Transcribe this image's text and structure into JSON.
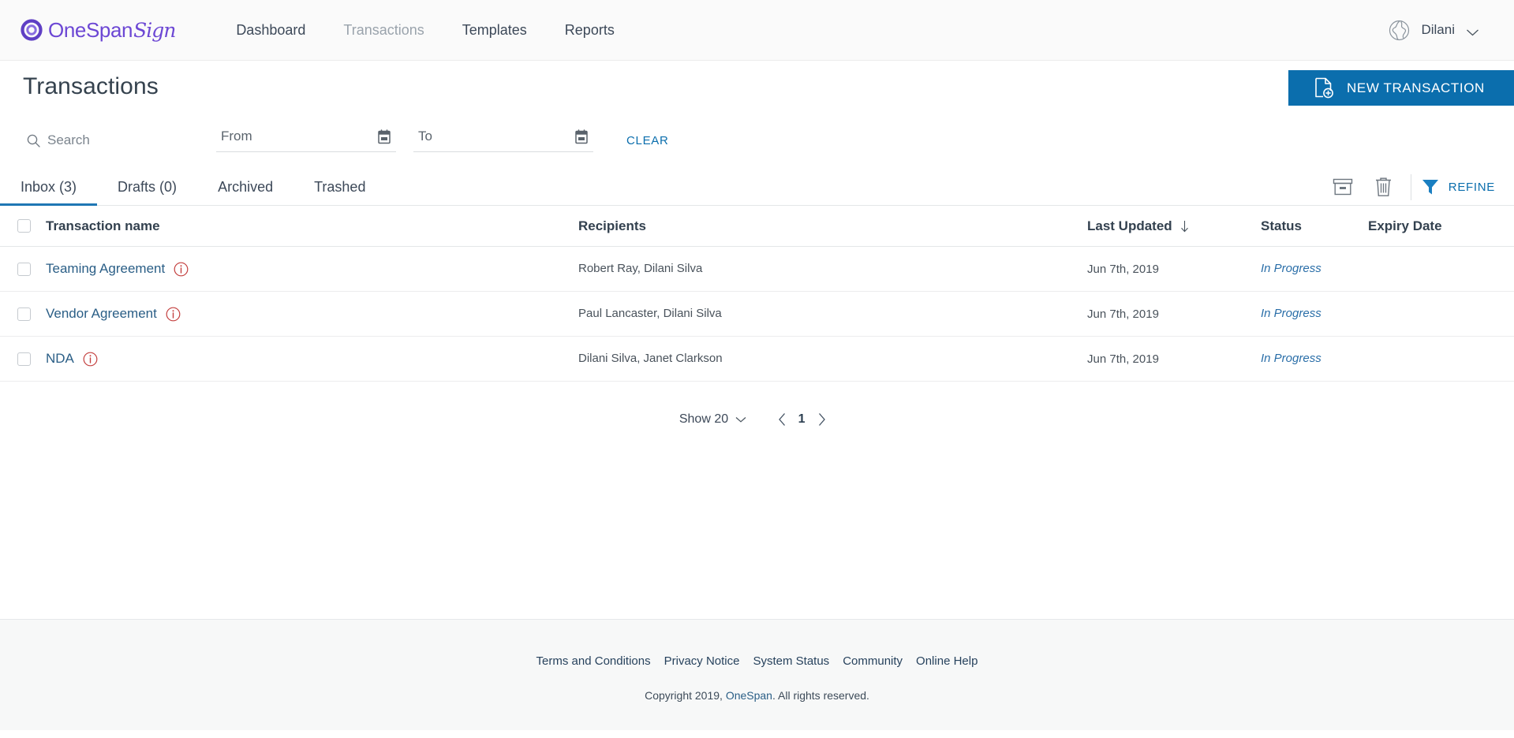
{
  "brand": {
    "logo_primary": "OneSpan",
    "logo_script": "Sign",
    "logo_color": "#6c47d4"
  },
  "topnav": {
    "items": [
      {
        "label": "Dashboard",
        "current": false
      },
      {
        "label": "Transactions",
        "current": true
      },
      {
        "label": "Templates",
        "current": false
      },
      {
        "label": "Reports",
        "current": false
      }
    ],
    "language_icon": "globe-icon",
    "user_name": "Dilani",
    "user_chevron": "chevron-down-icon"
  },
  "page": {
    "title": "Transactions",
    "new_transaction_label": "NEW TRANSACTION",
    "new_transaction_color": "#0b6ead"
  },
  "filters": {
    "search_placeholder": "Search",
    "search_value": "",
    "search_icon": "search-icon",
    "from_placeholder": "From",
    "from_value": "",
    "to_placeholder": "To",
    "to_value": "",
    "calendar_icon": "calendar-icon",
    "clear_label": "CLEAR"
  },
  "tabs": {
    "items": [
      {
        "label": "Inbox (3)",
        "active": true
      },
      {
        "label": "Drafts (0)",
        "active": false
      },
      {
        "label": "Archived",
        "active": false
      },
      {
        "label": "Trashed",
        "active": false
      }
    ],
    "active_underline_color": "#1f77b4",
    "actions": {
      "archive_icon": "archive-icon",
      "trash_icon": "trash-icon",
      "refine_icon": "filter-funnel-icon",
      "refine_label": "REFINE",
      "refine_color": "#0b6ead"
    }
  },
  "table": {
    "columns": {
      "name": "Transaction name",
      "recipients": "Recipients",
      "last_updated": "Last Updated",
      "status": "Status",
      "expiry": "Expiry Date"
    },
    "sort": {
      "column": "Last Updated",
      "direction": "desc",
      "icon": "arrow-down-icon"
    },
    "rows": [
      {
        "name": "Teaming Agreement",
        "info_icon": "info-circle-icon",
        "recipients": "Robert Ray, Dilani Silva",
        "last_updated": "Jun 7th, 2019",
        "status": "In Progress",
        "expiry": ""
      },
      {
        "name": "Vendor Agreement",
        "info_icon": "info-circle-icon",
        "recipients": "Paul Lancaster, Dilani Silva",
        "last_updated": "Jun 7th, 2019",
        "status": "In Progress",
        "expiry": ""
      },
      {
        "name": "NDA",
        "info_icon": "info-circle-icon",
        "recipients": "Dilani Silva, Janet Clarkson",
        "last_updated": "Jun 7th, 2019",
        "status": "In Progress",
        "expiry": ""
      }
    ]
  },
  "pagination": {
    "show_label": "Show 20",
    "show_chevron": "chevron-down-icon",
    "prev_icon": "chevron-left-icon",
    "next_icon": "chevron-right-icon",
    "current_page": "1"
  },
  "footer": {
    "links": [
      "Terms and Conditions",
      "Privacy Notice",
      "System Status",
      "Community",
      "Online Help"
    ],
    "copyright_prefix": "Copyright 2019, ",
    "copyright_brand": "OneSpan",
    "copyright_suffix": ". All rights reserved."
  }
}
